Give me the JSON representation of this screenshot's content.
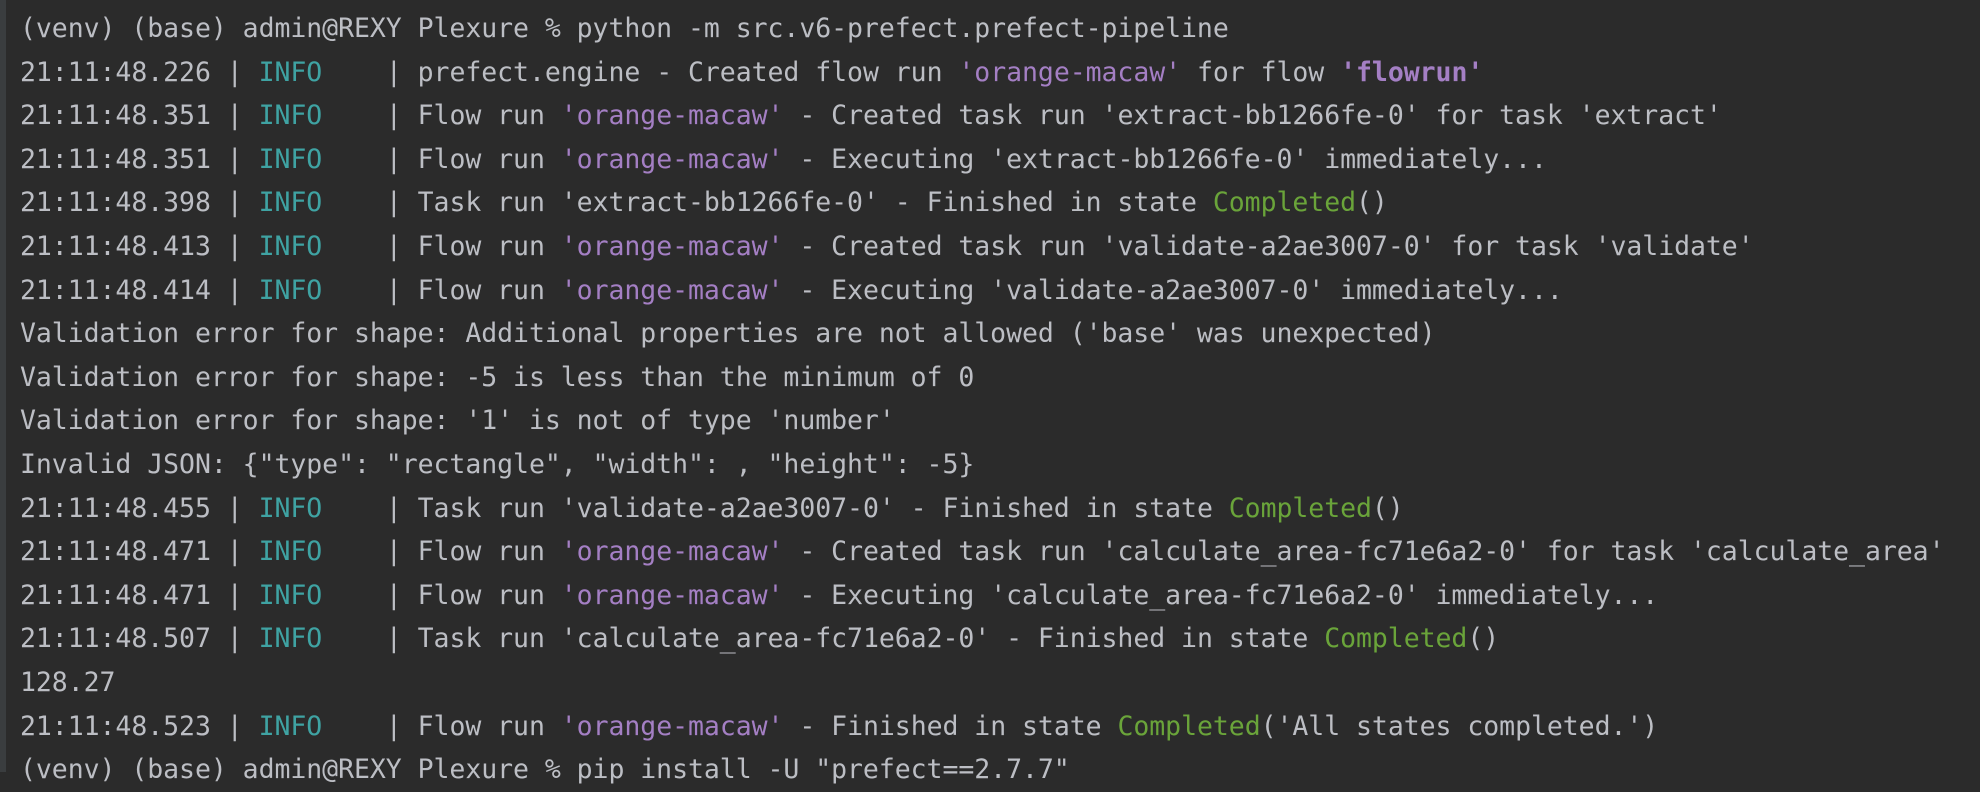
{
  "colors": {
    "background": "#2b2b2b",
    "text": "#bcbec4",
    "info_level": "#3fa3a3",
    "run_name": "#a47fc4",
    "state_completed": "#6aa43a"
  },
  "terminal": {
    "lines": [
      [
        {
          "t": "(venv) (base) admin@REXY Plexure % python -m src.v6-prefect.prefect-pipeline"
        }
      ],
      [
        {
          "t": "21:11:48.226 | "
        },
        {
          "t": "INFO",
          "c": "info"
        },
        {
          "t": "    | prefect.engine - Created flow run "
        },
        {
          "t": "'orange-macaw'",
          "c": "name"
        },
        {
          "t": " for flow "
        },
        {
          "t": "'flowrun'",
          "c": "bold"
        }
      ],
      [
        {
          "t": "21:11:48.351 | "
        },
        {
          "t": "INFO",
          "c": "info"
        },
        {
          "t": "    | Flow run "
        },
        {
          "t": "'orange-macaw'",
          "c": "name"
        },
        {
          "t": " - Created task run 'extract-bb1266fe-0' for task 'extract'"
        }
      ],
      [
        {
          "t": "21:11:48.351 | "
        },
        {
          "t": "INFO",
          "c": "info"
        },
        {
          "t": "    | Flow run "
        },
        {
          "t": "'orange-macaw'",
          "c": "name"
        },
        {
          "t": " - Executing 'extract-bb1266fe-0' immediately..."
        }
      ],
      [
        {
          "t": "21:11:48.398 | "
        },
        {
          "t": "INFO",
          "c": "info"
        },
        {
          "t": "    | Task run 'extract-bb1266fe-0' - Finished in state "
        },
        {
          "t": "Completed",
          "c": "ok"
        },
        {
          "t": "()"
        }
      ],
      [
        {
          "t": "21:11:48.413 | "
        },
        {
          "t": "INFO",
          "c": "info"
        },
        {
          "t": "    | Flow run "
        },
        {
          "t": "'orange-macaw'",
          "c": "name"
        },
        {
          "t": " - Created task run 'validate-a2ae3007-0' for task 'validate'"
        }
      ],
      [
        {
          "t": "21:11:48.414 | "
        },
        {
          "t": "INFO",
          "c": "info"
        },
        {
          "t": "    | Flow run "
        },
        {
          "t": "'orange-macaw'",
          "c": "name"
        },
        {
          "t": " - Executing 'validate-a2ae3007-0' immediately..."
        }
      ],
      [
        {
          "t": "Validation error for shape: Additional properties are not allowed ('base' was unexpected)"
        }
      ],
      [
        {
          "t": "Validation error for shape: -5 is less than the minimum of 0"
        }
      ],
      [
        {
          "t": "Validation error for shape: '1' is not of type 'number'"
        }
      ],
      [
        {
          "t": "Invalid JSON: {\"type\": \"rectangle\", \"width\": , \"height\": -5}"
        }
      ],
      [
        {
          "t": "21:11:48.455 | "
        },
        {
          "t": "INFO",
          "c": "info"
        },
        {
          "t": "    | Task run 'validate-a2ae3007-0' - Finished in state "
        },
        {
          "t": "Completed",
          "c": "ok"
        },
        {
          "t": "()"
        }
      ],
      [
        {
          "t": "21:11:48.471 | "
        },
        {
          "t": "INFO",
          "c": "info"
        },
        {
          "t": "    | Flow run "
        },
        {
          "t": "'orange-macaw'",
          "c": "name"
        },
        {
          "t": " - Created task run 'calculate_area-fc71e6a2-0' for task 'calculate_area'"
        }
      ],
      [
        {
          "t": "21:11:48.471 | "
        },
        {
          "t": "INFO",
          "c": "info"
        },
        {
          "t": "    | Flow run "
        },
        {
          "t": "'orange-macaw'",
          "c": "name"
        },
        {
          "t": " - Executing 'calculate_area-fc71e6a2-0' immediately..."
        }
      ],
      [
        {
          "t": "21:11:48.507 | "
        },
        {
          "t": "INFO",
          "c": "info"
        },
        {
          "t": "    | Task run 'calculate_area-fc71e6a2-0' - Finished in state "
        },
        {
          "t": "Completed",
          "c": "ok"
        },
        {
          "t": "()"
        }
      ],
      [
        {
          "t": "128.27"
        }
      ],
      [
        {
          "t": "21:11:48.523 | "
        },
        {
          "t": "INFO",
          "c": "info"
        },
        {
          "t": "    | Flow run "
        },
        {
          "t": "'orange-macaw'",
          "c": "name"
        },
        {
          "t": " - Finished in state "
        },
        {
          "t": "Completed",
          "c": "ok"
        },
        {
          "t": "('All states completed.')"
        }
      ],
      [
        {
          "t": "(venv) (base) admin@REXY Plexure % pip install -U \"prefect==2.7.7\""
        }
      ]
    ]
  }
}
